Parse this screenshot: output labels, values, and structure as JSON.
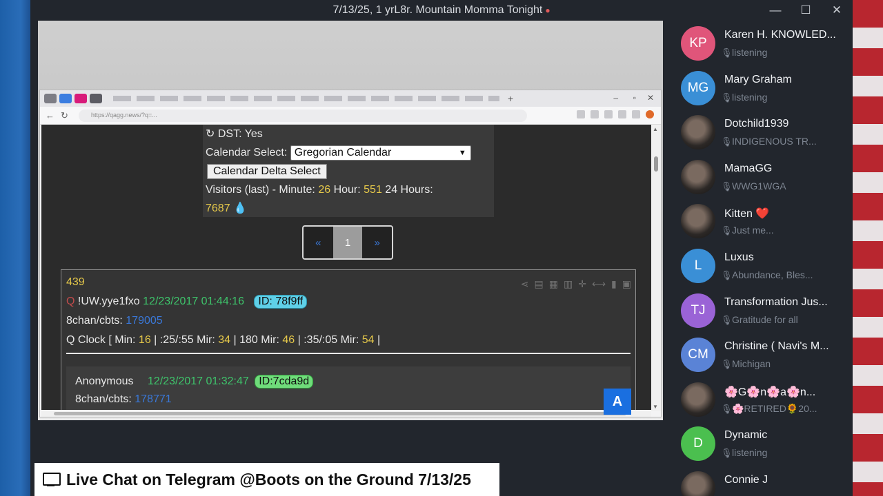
{
  "window": {
    "title": "7/13/25, 1 yrL8r. Mountain Momma Tonight",
    "recording_indicator": "●",
    "controls": {
      "minimize": "—",
      "maximize": "☐",
      "close": "✕"
    }
  },
  "shared_screen": {
    "browser": {
      "url": "https://qagg.news/?q=..."
    },
    "page": {
      "dst_line": "DST: Yes",
      "calendar_select_label": "Calendar Select:",
      "calendar_select_value": "Gregorian Calendar",
      "calendar_delta_button": "Calendar Delta Select",
      "visitors_label": "Visitors (last) - Minute:",
      "visitors_minute": "26",
      "visitors_hour_label": "Hour:",
      "visitors_hour": "551",
      "visitors_24h_label": "24 Hours:",
      "visitors_24h": "7687",
      "pagination": {
        "prev": "«",
        "current": "1",
        "next": "»"
      },
      "post": {
        "number": "439",
        "author": "!UW.yye1fxo",
        "date": "12/23/2017 01:44:16",
        "id": "ID: 78f9ff",
        "source_label": "8chan/cbts:",
        "source_value": "179005",
        "clock_prefix": "Q Clock [ Min:",
        "clock_min": "16",
        "clock_sep1": "| :25/:55 Mir:",
        "clock_2555": "34",
        "clock_sep2": "| 180 Mir:",
        "clock_180": "46",
        "clock_sep3": "| :35/:05 Mir:",
        "clock_3505": "54",
        "clock_end": "|"
      },
      "reply": {
        "author": "Anonymous",
        "date": "12/23/2017 01:32:47",
        "id": "ID:7cda9d",
        "source_label": "8chan/cbts:",
        "source_value": "178771"
      },
      "translate_button": "A"
    }
  },
  "participants": [
    {
      "initials": "KP",
      "name": "Karen H. KNOWLED...",
      "status": "listening",
      "color": "#e0557a"
    },
    {
      "initials": "MG",
      "name": "Mary Graham",
      "status": "listening",
      "color": "#3a8fd6"
    },
    {
      "initials": "",
      "name": "Dotchild1939",
      "status": "INDIGENOUS TR...",
      "color": "#1f3a66"
    },
    {
      "initials": "",
      "name": "MamaGG",
      "status": "WWG1WGA",
      "color": "#3a3030"
    },
    {
      "initials": "",
      "name": "Kitten ❤️",
      "status": "Just me...",
      "color": "#2a2020"
    },
    {
      "initials": "L",
      "name": "Luxus",
      "status": "Abundance, Bles...",
      "color": "#3a8fd6"
    },
    {
      "initials": "TJ",
      "name": "Transformation Jus...",
      "status": "Gratitude for all",
      "color": "#9a63d6"
    },
    {
      "initials": "CM",
      "name": "Christine ( Navi's M...",
      "status": "Michigan",
      "color": "#5a83d6"
    },
    {
      "initials": "",
      "name": "🌸G🌸n🌸a🌸n...",
      "status": "🌸RETIRED🌻20...",
      "color": "#c89a88"
    },
    {
      "initials": "D",
      "name": "Dynamic",
      "status": "listening",
      "color": "#4bbf4f"
    },
    {
      "initials": "",
      "name": "Connie J",
      "status": "",
      "color": "#b89a7a"
    }
  ],
  "banner": {
    "text": "Live Chat on Telegram @Boots on the Ground 7/13/25"
  }
}
